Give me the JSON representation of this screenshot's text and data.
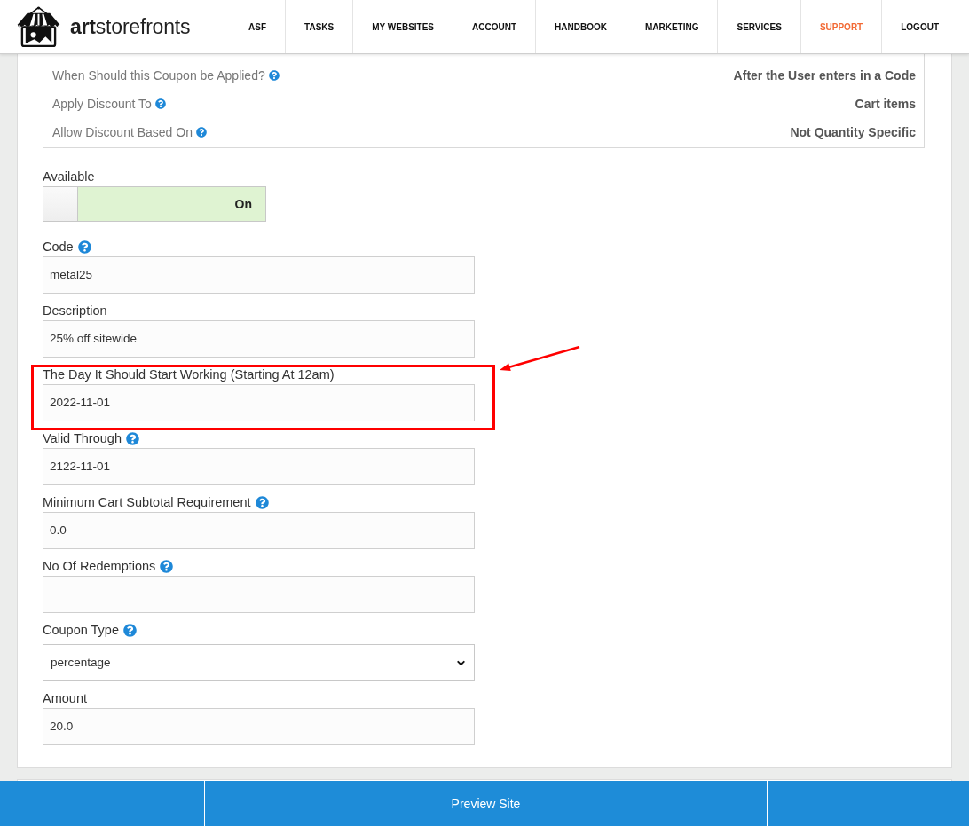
{
  "header": {
    "logo": {
      "text": "**art**storefronts"
    },
    "nav": [
      {
        "label": "ASF",
        "selected": false
      },
      {
        "label": "TASKS",
        "selected": false
      },
      {
        "label": "MY WEBSITES",
        "selected": false
      },
      {
        "label": "ACCOUNT",
        "selected": false
      },
      {
        "label": "HANDBOOK",
        "selected": false
      },
      {
        "label": "MARKETING",
        "selected": false
      },
      {
        "label": "SERVICES",
        "selected": false
      },
      {
        "label": "SUPPORT",
        "selected": true
      },
      {
        "label": "LOGOUT",
        "selected": false
      }
    ]
  },
  "coupon_summary": {
    "rows": [
      {
        "label": "When Should this Coupon be Applied?",
        "help": true,
        "value": "After the User enters in a Code"
      },
      {
        "label": "Apply Discount To",
        "help": true,
        "value": "Cart items"
      },
      {
        "label": "Allow Discount Based On",
        "help": true,
        "value": "Not Quantity Specific"
      }
    ]
  },
  "available": {
    "label": "Available",
    "on": true,
    "state_label": "On"
  },
  "fields": [
    {
      "kind": "text",
      "label": "Code",
      "help": true,
      "value": "metal25",
      "highlighted": false
    },
    {
      "kind": "text",
      "label": "Description",
      "help": false,
      "value": "25% off sitewide",
      "highlighted": false
    },
    {
      "kind": "text",
      "label": "The Day It Should Start Working (Starting At 12am)",
      "help": false,
      "value": "2022-11-01",
      "highlighted": true
    },
    {
      "kind": "text",
      "label": "Valid Through",
      "help": true,
      "value": "2122-11-01",
      "highlighted": false
    },
    {
      "kind": "text",
      "label": "Minimum Cart Subtotal Requirement",
      "help": true,
      "value": "0.0",
      "highlighted": false
    },
    {
      "kind": "text",
      "label": "No Of Redemptions",
      "help": true,
      "highlighted": false
    },
    {
      "kind": "select",
      "label": "Coupon Type",
      "help": true,
      "value": "percentage",
      "highlighted": false
    },
    {
      "kind": "text",
      "label": "Amount",
      "help": false,
      "value": "20.0",
      "highlighted": false
    }
  ],
  "bottom_bar": {
    "button": "Preview Site"
  }
}
